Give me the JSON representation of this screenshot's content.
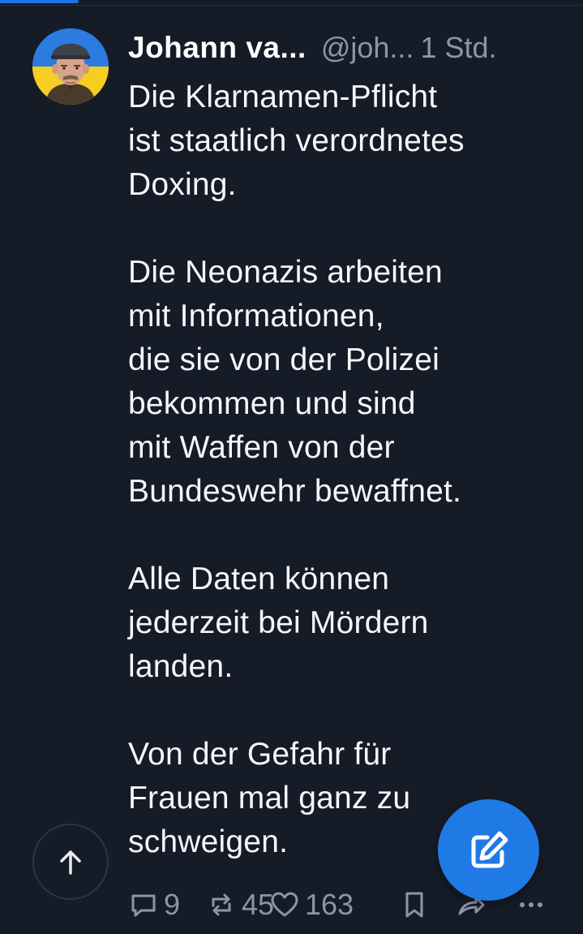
{
  "progress": {
    "fraction": 0.135,
    "color": "#1d73e8"
  },
  "post": {
    "author": {
      "display_name": "Johann va...",
      "handle": "@joh...",
      "avatar_icon": "avatar-portrait-ukraine-flag"
    },
    "time": "1 Std.",
    "text": "Die Klarnamen-Pflicht\nist staatlich verordnetes\nDoxing.\n\nDie Neonazis arbeiten\nmit Informationen,\ndie sie von der Polizei\nbekommen und sind\nmit Waffen von der\nBundeswehr bewaffnet.\n\nAlle Daten können\njederzeit bei Mördern\nlanden.\n\nVon der Gefahr für\nFrauen mal ganz zu\nschweigen.",
    "actions": {
      "replies": "9",
      "reposts": "45",
      "likes": "163"
    }
  },
  "buttons": {
    "scroll_top_icon": "arrow-up-icon",
    "compose_icon": "edit-icon"
  },
  "colors": {
    "background": "#151c27",
    "accent": "#1f7ae6",
    "muted": "#8a96a8",
    "text": "#f4f7fa"
  }
}
